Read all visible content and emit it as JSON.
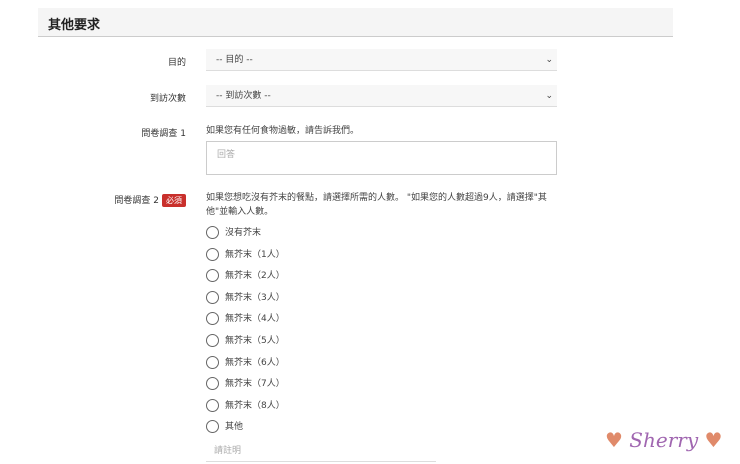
{
  "section_title": "其他要求",
  "purpose": {
    "label": "目的",
    "value": "-- 目的 --"
  },
  "visits": {
    "label": "到訪次數",
    "value": "-- 到訪次數 --"
  },
  "q1": {
    "label": "問卷調查 1",
    "question": "如果您有任何食物過敏，請告訴我們。",
    "placeholder": "回答"
  },
  "q2": {
    "label": "問卷調查 2",
    "required": "必須",
    "question": "如果您想吃沒有芥末的餐點，請選擇所需的人數。 \"如果您的人數超過9人，請選擇\"其他\"並輸入人數。",
    "options": [
      "沒有芥末",
      "無芥末（1人）",
      "無芥末（2人）",
      "無芥末（3人）",
      "無芥末（4人）",
      "無芥末（5人）",
      "無芥末（6人）",
      "無芥末（7人）",
      "無芥末（8人）",
      "其他"
    ],
    "other_placeholder": "請註明"
  },
  "signature": "Sherry"
}
